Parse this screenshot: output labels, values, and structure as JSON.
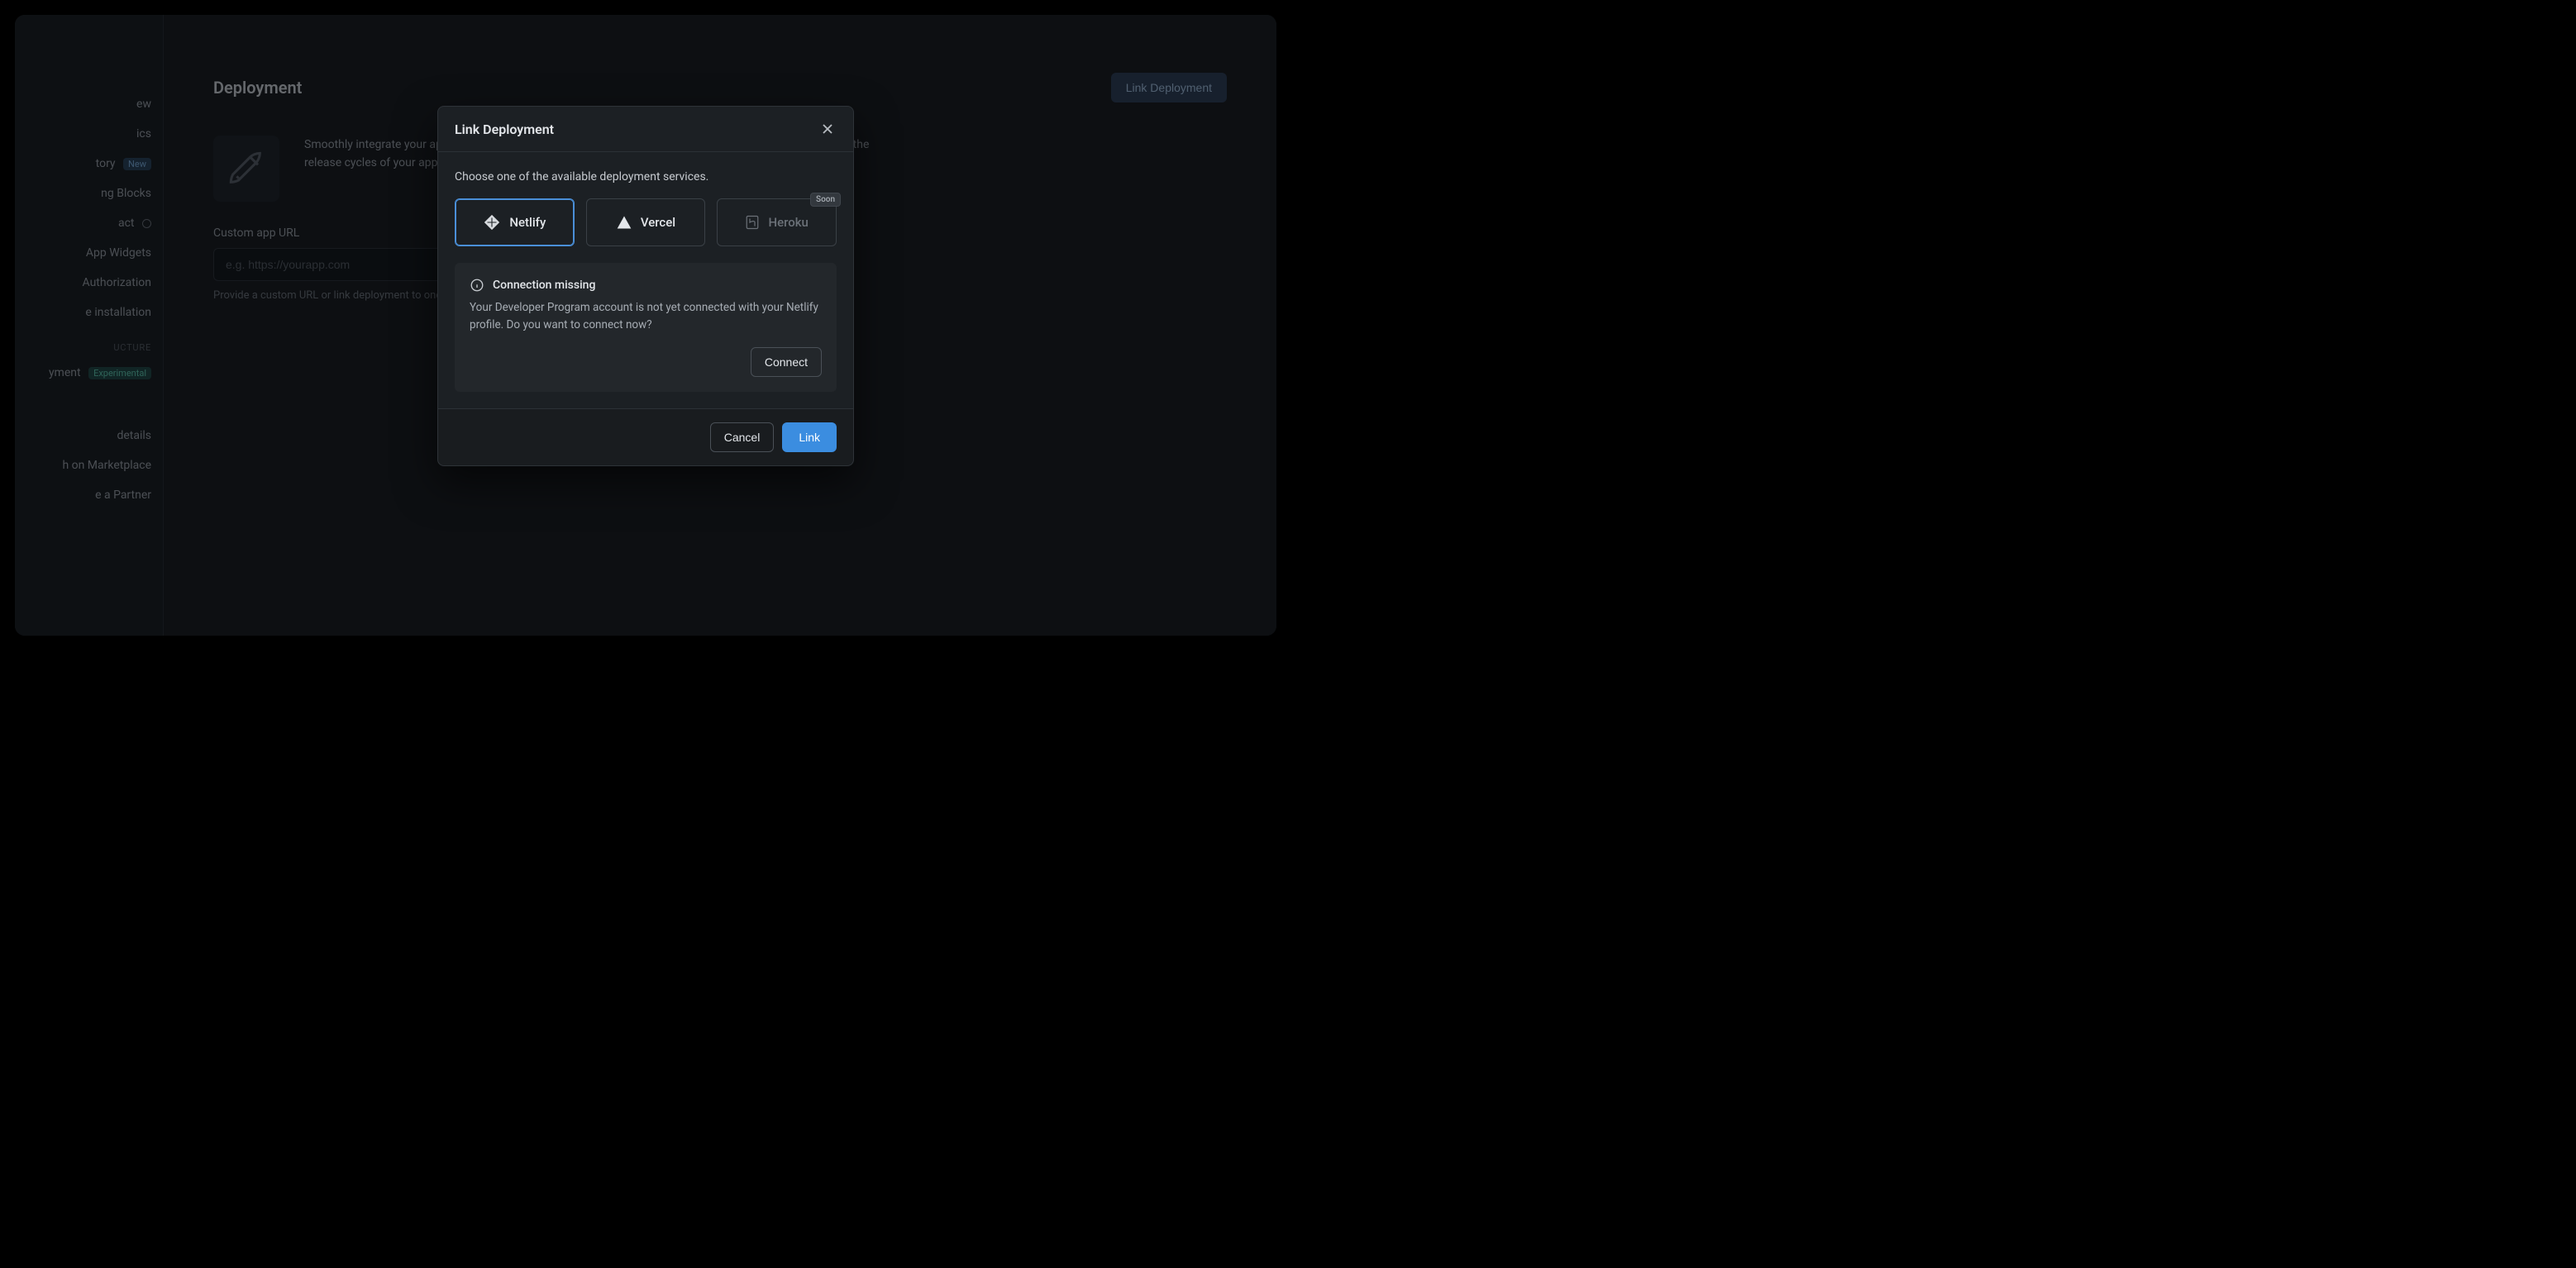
{
  "sidebar": {
    "items": [
      {
        "label": "ew"
      },
      {
        "label": "ics"
      },
      {
        "label": "tory",
        "badge_text": "New",
        "badge_class": "badge-blue"
      },
      {
        "label": "ng Blocks"
      },
      {
        "label": "act",
        "has_target_icon": true
      },
      {
        "label": " App Widgets"
      },
      {
        "label": "Authorization"
      },
      {
        "label": "e installation"
      }
    ],
    "section_label": "UCTURE",
    "after_section": [
      {
        "label": "yment",
        "badge_text": "Experimental",
        "badge_class": "badge-teal"
      }
    ],
    "footer": [
      {
        "label": " details"
      },
      {
        "label": "h on Marketplace"
      },
      {
        "label": "e a Partner"
      }
    ]
  },
  "main": {
    "title": "Deployment",
    "link_button": "Link Deployment",
    "rocket_desc": "Smoothly integrate your app with the Developer Program. Connect your deployment provider and automate the release cycles of your application.",
    "form_label": "Custom app URL",
    "input_placeholder": "e.g. https://yourapp.com",
    "helper_text": "Provide a custom URL or link deployment to one of the available services."
  },
  "modal": {
    "title": "Link Deployment",
    "description": "Choose one of the available deployment services.",
    "providers": [
      {
        "name": "Netlify",
        "icon": "netlify",
        "state": "selected"
      },
      {
        "name": "Vercel",
        "icon": "vercel",
        "state": "normal"
      },
      {
        "name": "Heroku",
        "icon": "heroku",
        "state": "disabled",
        "soon": "Soon"
      }
    ],
    "notice": {
      "title": "Connection missing",
      "body": "Your Developer Program account is not yet connected with your Netlify profile. Do you want to connect now?",
      "connect_label": "Connect"
    },
    "footer": {
      "cancel": "Cancel",
      "link": "Link"
    }
  }
}
